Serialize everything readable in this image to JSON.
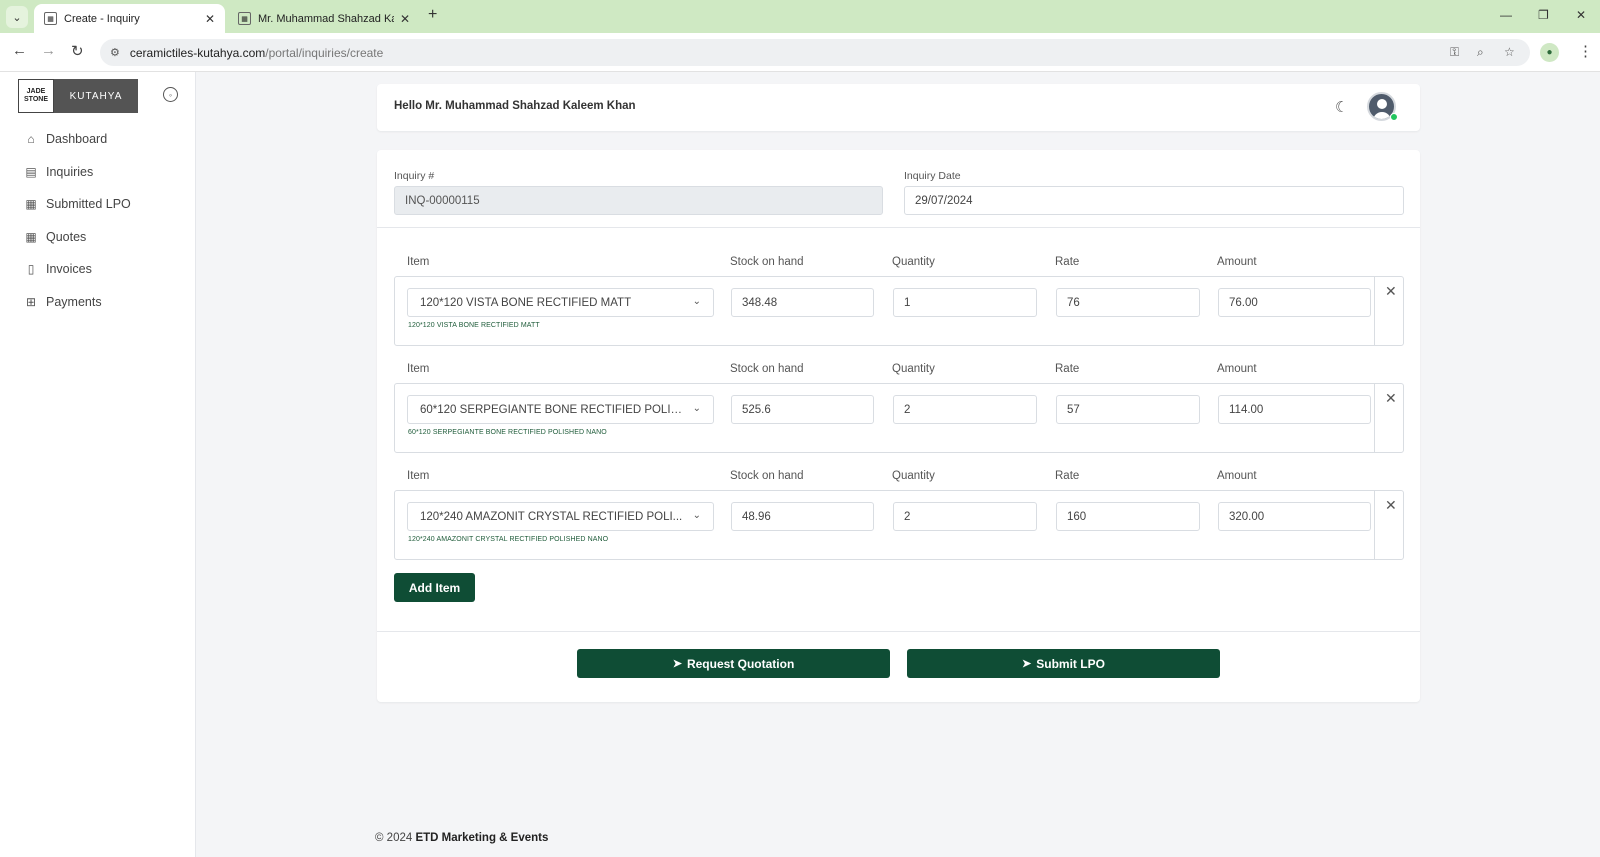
{
  "browser": {
    "tabs": [
      {
        "title": "Create - Inquiry",
        "active": true
      },
      {
        "title": "Mr. Muhammad Shahzad Kalee",
        "active": false
      }
    ],
    "url_host": "ceramictiles-kutahya.com",
    "url_path": "/portal/inquiries/create"
  },
  "logo": {
    "left_line1": "JADE",
    "left_line2": "STONE",
    "right": "KUTAHYA"
  },
  "sidebar": {
    "items": [
      {
        "label": "Dashboard",
        "icon": "home-icon"
      },
      {
        "label": "Inquiries",
        "icon": "clipboard-search-icon"
      },
      {
        "label": "Submitted LPO",
        "icon": "calendar-icon"
      },
      {
        "label": "Quotes",
        "icon": "calendar-icon"
      },
      {
        "label": "Invoices",
        "icon": "invoice-icon"
      },
      {
        "label": "Payments",
        "icon": "payments-icon"
      }
    ]
  },
  "header": {
    "greeting": "Hello Mr. Muhammad Shahzad Kaleem Khan"
  },
  "form": {
    "inquiry_no_label": "Inquiry #",
    "inquiry_no_value": "INQ-00000115",
    "inquiry_date_label": "Inquiry Date",
    "inquiry_date_value": "29/07/2024"
  },
  "columns": {
    "item": "Item",
    "stock": "Stock on hand",
    "quantity": "Quantity",
    "rate": "Rate",
    "amount": "Amount"
  },
  "items": [
    {
      "name": "120*120 VISTA BONE RECTIFIED MATT",
      "hint": "120*120 VISTA BONE RECTIFIED MATT",
      "stock": "348.48",
      "quantity": "1",
      "rate": "76",
      "amount": "76.00"
    },
    {
      "name": "60*120 SERPEGIANTE BONE RECTIFIED POLIS...",
      "hint": "60*120 SERPEGIANTE BONE RECTIFIED POLISHED NANO",
      "stock": "525.6",
      "quantity": "2",
      "rate": "57",
      "amount": "114.00"
    },
    {
      "name": "120*240 AMAZONIT CRYSTAL RECTIFIED POLI...",
      "hint": "120*240 AMAZONIT CRYSTAL RECTIFIED POLISHED NANO",
      "stock": "48.96",
      "quantity": "2",
      "rate": "160",
      "amount": "320.00"
    }
  ],
  "buttons": {
    "add_item": "Add Item",
    "request_quotation": "Request Quotation",
    "submit_lpo": "Submit LPO"
  },
  "footer": {
    "copyright": "© 2024",
    "company": "ETD Marketing & Events"
  },
  "colors": {
    "brand_green": "#0f4d35",
    "tab_bar": "#cfe9c3"
  }
}
